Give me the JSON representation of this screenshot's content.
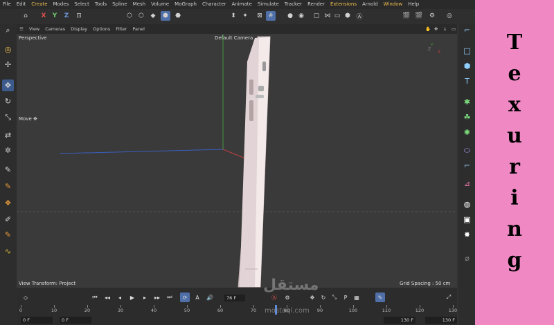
{
  "menubar": [
    "File",
    "Edit",
    "Create",
    "Modes",
    "Select",
    "Tools",
    "Spline",
    "Mesh",
    "Volume",
    "MoGraph",
    "Character",
    "Animate",
    "Simulate",
    "Tracker",
    "Render",
    "Extensions",
    "Arnold",
    "Window",
    "Help"
  ],
  "menubar_highlight": [
    "Create",
    "Extensions",
    "Window"
  ],
  "toolbar": {
    "axis_x": "X",
    "axis_y": "Y",
    "axis_z": "Z"
  },
  "viewport_menu": [
    "View",
    "Cameras",
    "Display",
    "Options",
    "Filter",
    "Panel"
  ],
  "viewport": {
    "name": "Perspective",
    "camera": "Default Camera",
    "tool_label": "Move",
    "view_transform": "View Transform: Project",
    "grid_spacing": "Grid Spacing : 50 cm"
  },
  "timeline": {
    "current_frame": "76 F",
    "start_a": "0 F",
    "start_b": "0 F",
    "end_a": "130 F",
    "end_b": "130 F",
    "ruler_labels": [
      "0",
      "10",
      "20",
      "30",
      "40",
      "50",
      "60",
      "70",
      "80",
      "90",
      "100",
      "110",
      "120",
      "130"
    ]
  },
  "side_panel": {
    "letters": [
      "T",
      "e",
      "x",
      "u",
      "r",
      "i",
      "n",
      "g"
    ],
    "color": "#f088c4"
  },
  "watermark": {
    "arabic": "مستقل",
    "latin": "mostaql.com"
  },
  "colors": {
    "selected": "#4f6fa8",
    "axis_x": "#e05050",
    "axis_y": "#6fce6f",
    "axis_z": "#6f9be0"
  }
}
